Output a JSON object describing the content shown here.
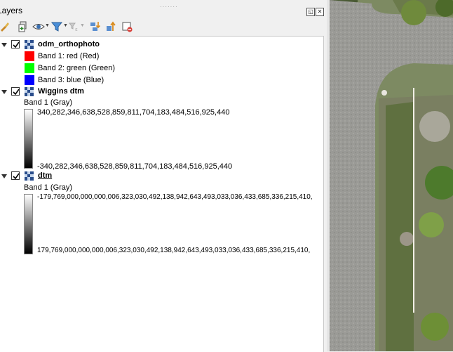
{
  "panel": {
    "title": "Layers"
  },
  "layers": [
    {
      "name": "odm_orthophoto",
      "bands": [
        {
          "label": "Band 1: red (Red)",
          "color": "#ff0000"
        },
        {
          "label": "Band 2: green (Green)",
          "color": "#00ff00"
        },
        {
          "label": "Band 3: blue (Blue)",
          "color": "#0000ff"
        }
      ]
    },
    {
      "name": "Wiggins dtm",
      "band_label": "Band 1 (Gray)",
      "max_value": "340,282,346,638,528,859,811,704,183,484,516,925,440",
      "min_value": "-340,282,346,638,528,859,811,704,183,484,516,925,440"
    },
    {
      "name": "dtm",
      "band_label": "Band 1 (Gray)",
      "max_value": "-179,769,000,000,000,006,323,030,492,138,942,643,493,033,036,433,685,336,215,410,",
      "min_value": "179,769,000,000,000,006,323,030,492,138,942,643,493,033,036,433,685,336,215,410,"
    }
  ],
  "colors": {
    "panel_bg": "#f0f0f0",
    "tree_bg": "#ffffff",
    "accent_red": "#d9413b"
  }
}
